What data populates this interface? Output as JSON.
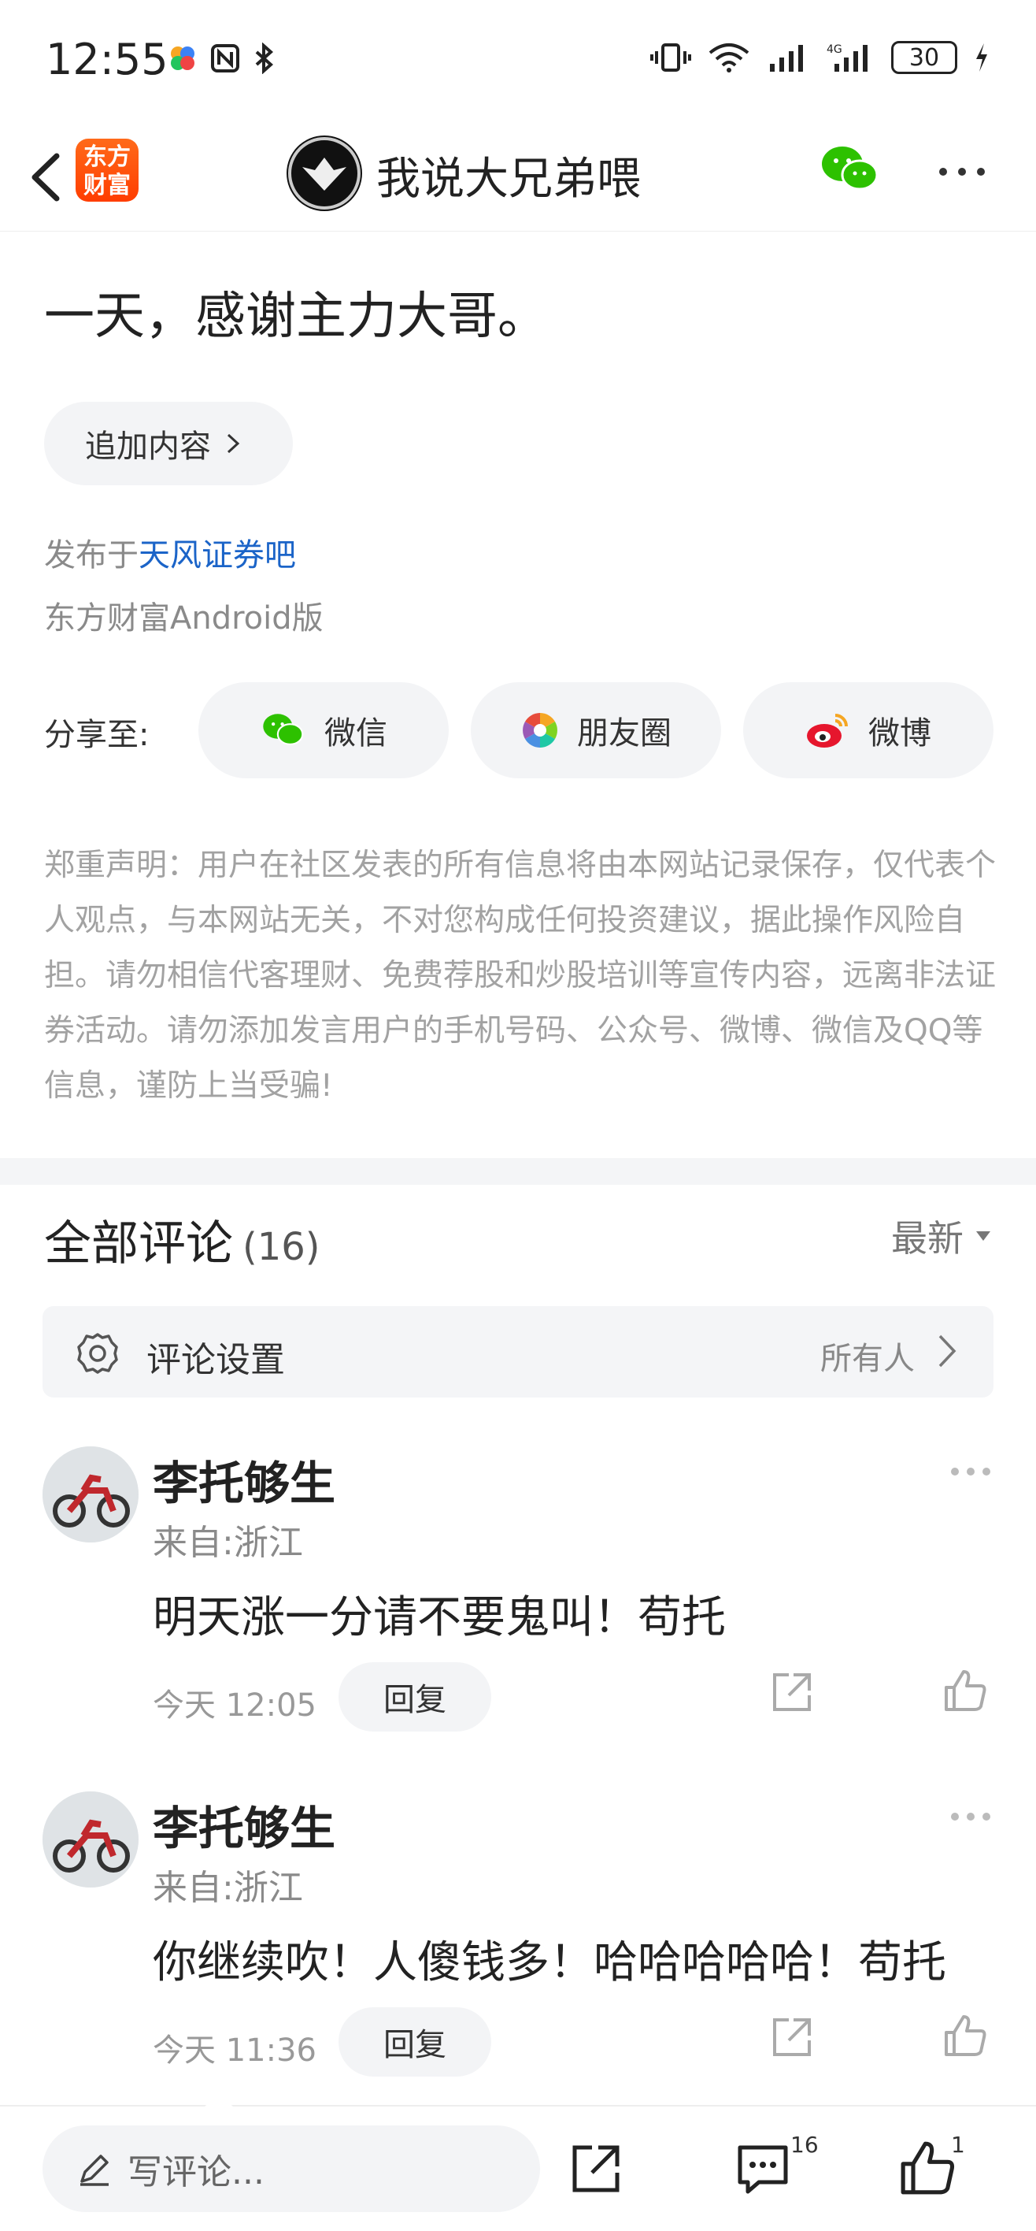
{
  "status": {
    "time": "12:55",
    "battery": "30"
  },
  "header": {
    "app_logo": "东方财富",
    "title": "我说大兄弟喂"
  },
  "post": {
    "cut_line": "……",
    "last_line": "一天，感谢主力大哥。",
    "add_content": "追加内容",
    "published_prefix": "发布于",
    "published_bar": "天风证券吧",
    "source": "东方财富Android版"
  },
  "share": {
    "label": "分享至:",
    "items": [
      {
        "label": "微信",
        "icon": "wechat-icon"
      },
      {
        "label": "朋友圈",
        "icon": "moments-icon"
      },
      {
        "label": "微博",
        "icon": "weibo-icon"
      }
    ]
  },
  "disclaimer": "郑重声明：用户在社区发表的所有信息将由本网站记录保存，仅代表个人观点，与本网站无关，不对您构成任何投资建议，据此操作风险自担。请勿相信代客理财、免费荐股和炒股培训等宣传内容，远离非法证券活动。请勿添加发言用户的手机号码、公众号、微博、微信及QQ等信息，谨防上当受骗!",
  "comments_section": {
    "title": "全部评论",
    "count": "(16)",
    "sort": "最新",
    "settings_label": "评论设置",
    "settings_value": "所有人"
  },
  "comments": [
    {
      "name": "李托够生",
      "from": "来自:浙江",
      "text": "明天涨一分请不要鬼叫！苟托",
      "time": "今天 12:05",
      "reply": "回复"
    },
    {
      "name": "李托够生",
      "from": "来自:浙江",
      "text": "你继续吹！人傻钱多！哈哈哈哈哈！苟托",
      "time": "今天 11:36",
      "reply": "回复"
    }
  ],
  "bottom": {
    "placeholder": "写评论...",
    "comment_count": "16",
    "like_count": "1"
  },
  "colors": {
    "accent_link": "#1b64c8",
    "brand": "#ff5a0a"
  }
}
